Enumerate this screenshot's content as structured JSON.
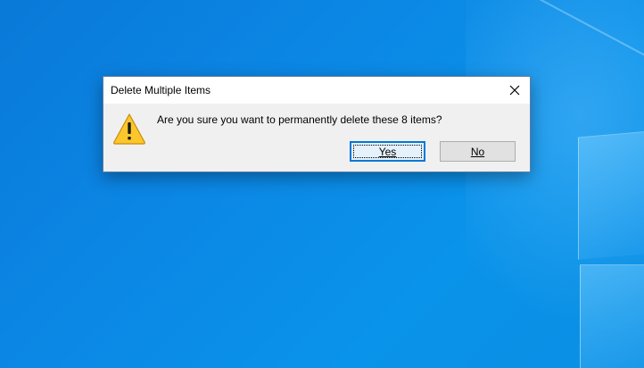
{
  "colors": {
    "desktop_blue": "#0a86e2",
    "dialog_bg": "#f0f0f0",
    "accent": "#0078d7",
    "warning_yellow": "#fcc72c"
  },
  "dialog": {
    "title": "Delete Multiple Items",
    "close_icon": "close-icon",
    "warning_icon": "warning-icon",
    "message": "Are you sure you want to permanently delete these 8 items?",
    "buttons": {
      "yes_label": "Yes",
      "no_label": "No",
      "default": "Yes"
    }
  }
}
